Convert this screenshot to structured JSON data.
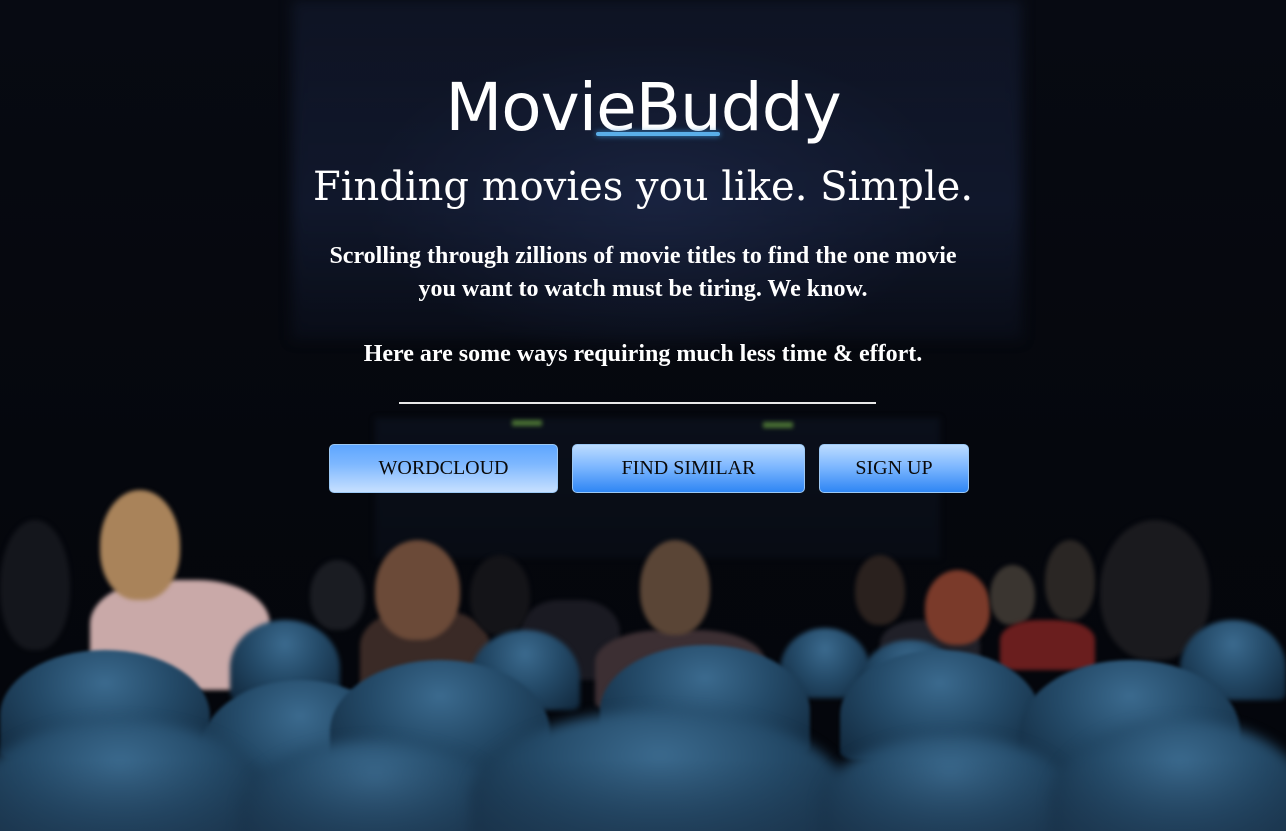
{
  "brand": {
    "name": "MovieBuddy"
  },
  "hero": {
    "tagline": "Finding movies you like. Simple.",
    "description": "Scrolling through zillions of movie titles to find the one movie you want to watch must be tiring. We know.",
    "sub_description": "Here are some ways requiring much less time & effort."
  },
  "actions": {
    "wordcloud_label": "WORDCLOUD",
    "find_similar_label": "FIND SIMILAR",
    "sign_up_label": "SIGN UP"
  },
  "colors": {
    "text": "#ffffff",
    "button_blue": "#4a98ff",
    "accent_underline": "#5aaee8"
  }
}
